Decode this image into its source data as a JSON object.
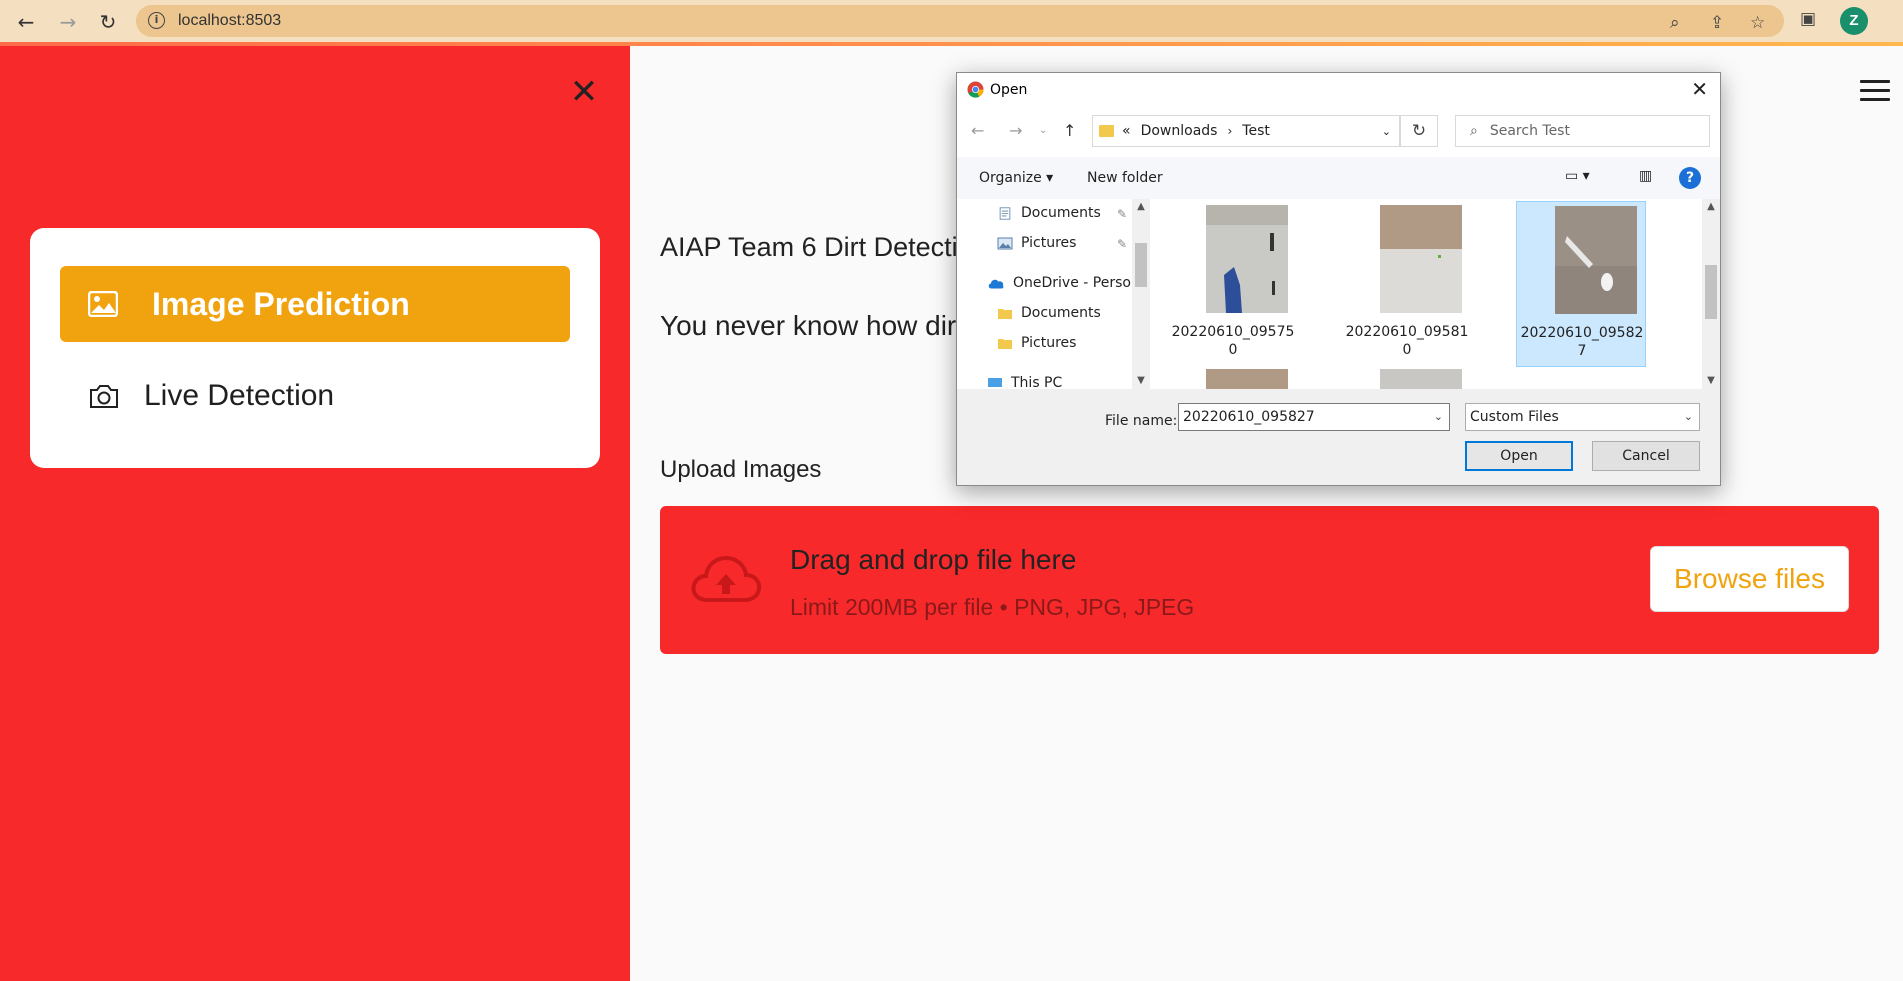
{
  "browser": {
    "url": "localhost:8503",
    "profile_initial": "Z"
  },
  "sidebar": {
    "items": [
      {
        "label": "Image Prediction",
        "icon": "image-icon",
        "active": true
      },
      {
        "label": "Live Detection",
        "icon": "camera-icon",
        "active": false
      }
    ],
    "colors": {
      "background": "#f8292a",
      "active_item": "#f0a30f"
    }
  },
  "main": {
    "title": "AIAP Team 6 Dirt Detecti",
    "subtitle": "You never know how dir",
    "upload_label": "Upload Images",
    "dropzone": {
      "title": "Drag and drop file here",
      "limit": "Limit 200MB per file • PNG, JPG, JPEG",
      "browse_label": "Browse files"
    }
  },
  "dialog": {
    "title": "Open",
    "path": {
      "prefix": "«",
      "folders": [
        "Downloads",
        "Test"
      ]
    },
    "search_placeholder": "Search Test",
    "toolbar": {
      "organize": "Organize",
      "new_folder": "New folder"
    },
    "nav_items": [
      {
        "label": "Documents",
        "pinned": true,
        "icon": "documents-icon"
      },
      {
        "label": "Pictures",
        "pinned": true,
        "icon": "pictures-icon"
      },
      {
        "label": "OneDrive - Person",
        "pinned": false,
        "icon": "cloud-icon"
      },
      {
        "label": "Documents",
        "pinned": false,
        "icon": "folder-icon"
      },
      {
        "label": "Pictures",
        "pinned": false,
        "icon": "folder-icon"
      },
      {
        "label": "This PC",
        "pinned": false,
        "icon": "pc-icon"
      }
    ],
    "files": [
      {
        "name": "20220610_095750",
        "selected": false
      },
      {
        "name": "20220610_095810",
        "selected": false
      },
      {
        "name": "20220610_095827",
        "selected": true
      }
    ],
    "file_name_label": "File name:",
    "file_name_value": "20220610_095827",
    "file_type": "Custom Files",
    "open_label": "Open",
    "cancel_label": "Cancel"
  }
}
